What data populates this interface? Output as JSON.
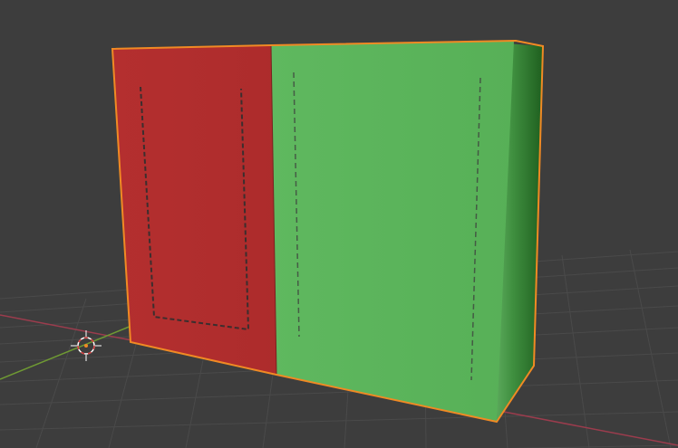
{
  "viewport": {
    "background": "#3d3d3d",
    "grid_color": "#4a4a4a",
    "x_axis_color": "#9b3c4d",
    "y_axis_color": "#6f9a33"
  },
  "object": {
    "selected": true,
    "selection_outline_color": "#f08a24",
    "front_left_color": "#b22f2f",
    "front_right_color": "#5cb85c",
    "side_color": "#2f7f2f",
    "door_outline_color": "#2f2f2f"
  },
  "cursor": {
    "icon": "3d-cursor-icon",
    "ring_color": "#ffffff",
    "ring_dash_color": "#d63b3b"
  }
}
